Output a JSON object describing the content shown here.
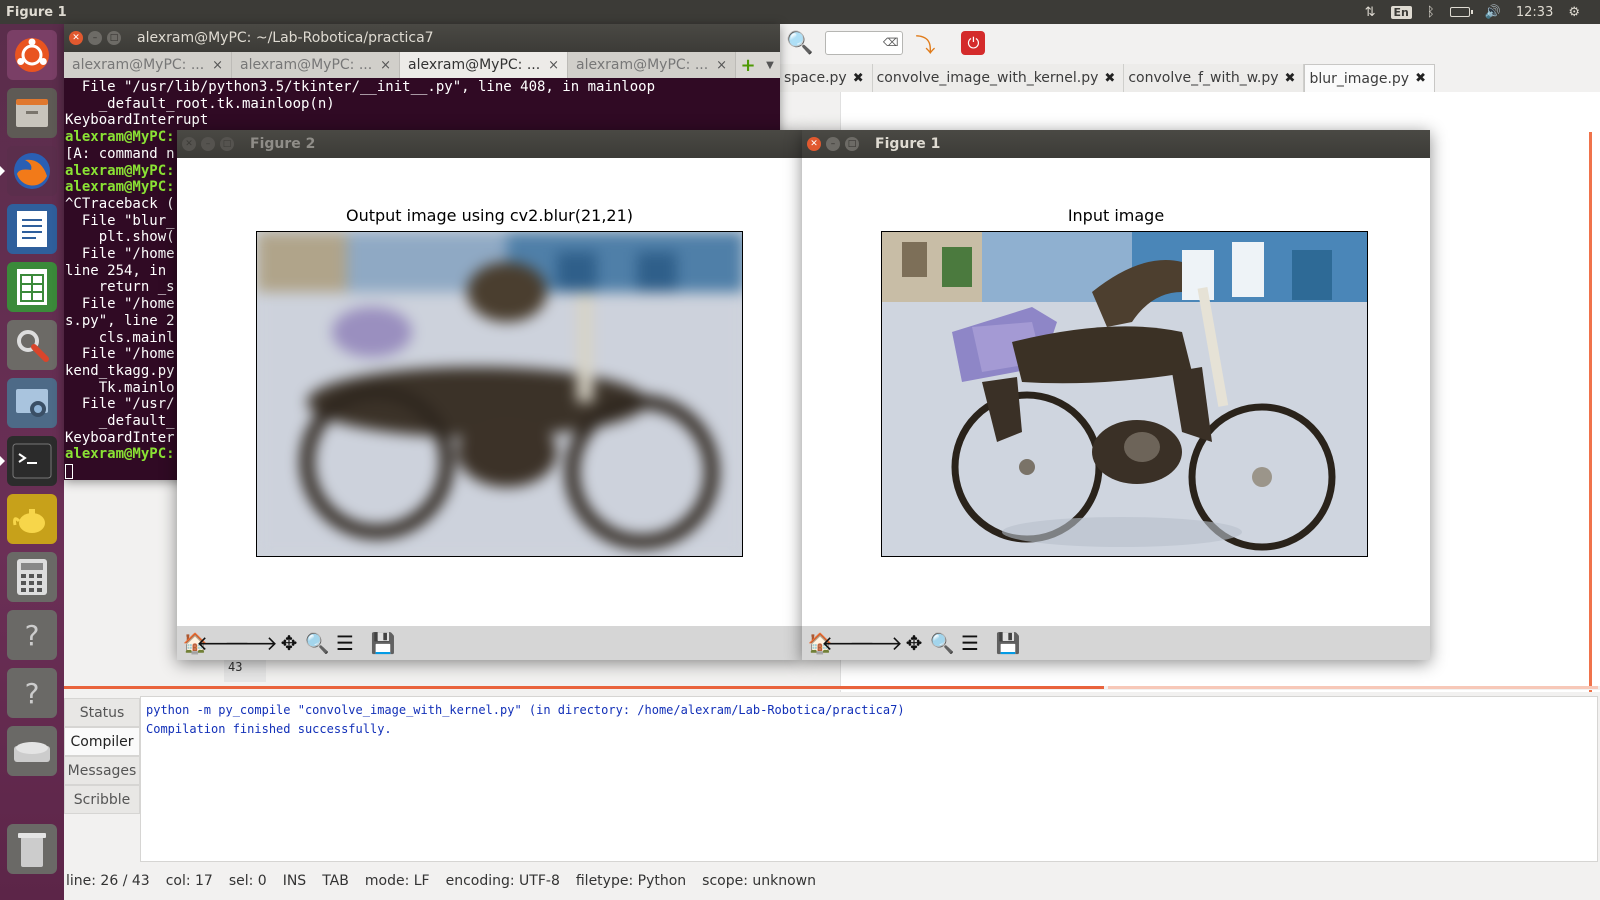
{
  "top_panel": {
    "app_title": "Figure 1",
    "lang": "En",
    "clock": "12:33"
  },
  "launcher": {
    "items": [
      "ubuntu-dash",
      "files",
      "firefox",
      "writer",
      "calc",
      "system-settings",
      "screenshot",
      "terminal",
      "teapot",
      "calculator",
      "help",
      "help",
      "drive",
      "trash"
    ]
  },
  "terminal": {
    "title": "alexram@MyPC: ~/Lab-Robotica/practica7",
    "tabs": [
      {
        "label": "alexram@MyPC: ..."
      },
      {
        "label": "alexram@MyPC: ..."
      },
      {
        "label": "alexram@MyPC: ..."
      },
      {
        "label": "alexram@MyPC: ..."
      }
    ],
    "lines": [
      "  File \"/usr/lib/python3.5/tkinter/__init__.py\", line 408, in mainloop",
      "    _default_root.tk.mainloop(n)",
      "KeyboardInterrupt",
      "[A: command n",
      "^CTraceback (",
      "  File \"blur_",
      "    plt.show(",
      "  File \"/home",
      "line 254, in",
      "    return _s",
      "  File \"/home",
      "s.py\", line 2",
      "    cls.mainl",
      "  File \"/home",
      "kend_tkagg.py",
      "    Tk.mainlo",
      "  File \"/usr/",
      "    _default_",
      "KeyboardInter"
    ],
    "prompt": "alexram@MyPC:"
  },
  "geany": {
    "tabs": [
      {
        "label": "space.py"
      },
      {
        "label": "convolve_image_with_kernel.py"
      },
      {
        "label": "convolve_f_with_w.py"
      },
      {
        "label": "blur_image.py"
      }
    ],
    "visible_line_number": "43",
    "message_tabs": [
      "Status",
      "Compiler",
      "Messages",
      "Scribble"
    ],
    "compiler_output": [
      "python -m py_compile \"convolve_image_with_kernel.py\" (in directory: /home/alexram/Lab-Robotica/practica7)",
      "Compilation finished successfully."
    ],
    "status": {
      "line": "line: 26 / 43",
      "col": "col: 17",
      "sel": "sel: 0",
      "ins": "INS",
      "tab": "TAB",
      "mode": "mode: LF",
      "encoding": "encoding: UTF-8",
      "filetype": "filetype: Python",
      "scope": "scope: unknown"
    }
  },
  "figure2": {
    "window_title": "Figure 2",
    "plot_title": "Output image using cv2.blur(21,21)"
  },
  "figure1": {
    "window_title": "Figure 1",
    "plot_title": "Input image"
  },
  "colors": {
    "terminal_bg": "#300a24",
    "prompt": "#8ae234",
    "accent": "#e9633c"
  }
}
